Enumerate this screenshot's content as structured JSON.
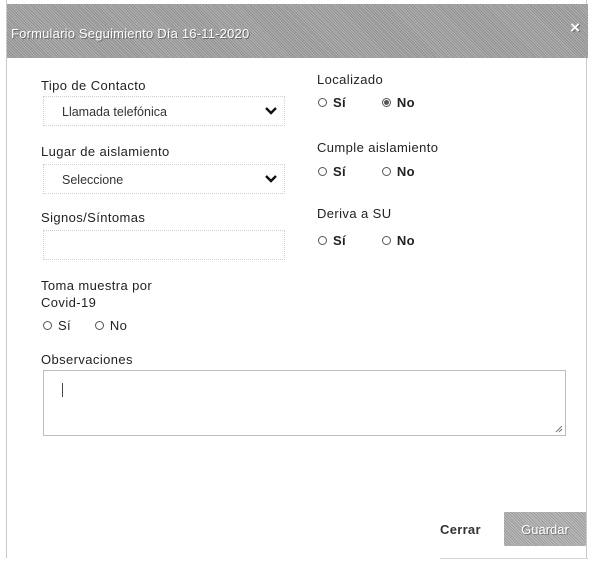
{
  "modal": {
    "title": "Formulario Seguimiento Día 16-11-2020",
    "close_icon": "×"
  },
  "form": {
    "tipo_contacto": {
      "label": "Tipo de Contacto",
      "value": "Llamada telefónica"
    },
    "localizado": {
      "label": "Localizado",
      "options": [
        "Sí",
        "No"
      ],
      "selected": "No"
    },
    "lugar_aislamiento": {
      "label": "Lugar de aislamiento",
      "value": "Seleccione"
    },
    "cumple_aislamiento": {
      "label": "Cumple aislamiento",
      "options": [
        "Sí",
        "No"
      ],
      "selected": null
    },
    "signos_sintomas": {
      "label": "Signos/Síntomas",
      "value": ""
    },
    "deriva_su": {
      "label": "Deriva a SU",
      "options": [
        "Sí",
        "No"
      ],
      "selected": null
    },
    "toma_muestra": {
      "label_line1": "Toma muestra por",
      "label_line2": "Covid-19",
      "options": [
        "Sí",
        "No"
      ],
      "selected": null
    },
    "observaciones": {
      "label": "Observaciones",
      "value": ""
    }
  },
  "footer": {
    "cerrar_label": "Cerrar",
    "guardar_label": "Guardar"
  },
  "icons": {
    "close": "close-icon",
    "dropdown": "chevron-down-icon",
    "resize": "resize-grip-icon"
  }
}
